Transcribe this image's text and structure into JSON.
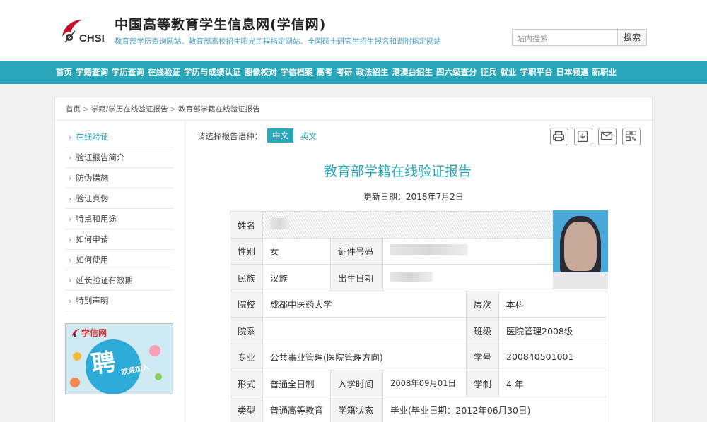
{
  "header": {
    "logo_text": "CHSI",
    "site_title": "中国高等教育学生信息网(学信网)",
    "site_subtitle": "教育部学历查询网站、教育部高校招生阳光工程指定网站、全国硕士研究生招生报名和调剂指定网站",
    "search_placeholder": "站内搜索",
    "search_button": "搜索"
  },
  "nav": [
    "首页",
    "学籍查询",
    "学历查询",
    "在线验证",
    "学历与成绩认证",
    "图像校对",
    "学信档案",
    "高考",
    "考研",
    "政法招生",
    "港澳台招生",
    "四六级查分",
    "征兵",
    "就业",
    "学职平台",
    "日本频道",
    "新职业"
  ],
  "breadcrumb": [
    "首页",
    "学籍/学历在线验证报告",
    "教育部学籍在线验证报告"
  ],
  "sidebar": {
    "items": [
      {
        "label": "在线验证",
        "active": true
      },
      {
        "label": "验证报告简介",
        "active": false
      },
      {
        "label": "防伪措施",
        "active": false
      },
      {
        "label": "验证真伪",
        "active": false
      },
      {
        "label": "特点和用途",
        "active": false
      },
      {
        "label": "如何申请",
        "active": false
      },
      {
        "label": "如何使用",
        "active": false
      },
      {
        "label": "延长验证有效期",
        "active": false
      },
      {
        "label": "特别声明",
        "active": false
      }
    ],
    "banner": {
      "logo": "学信网",
      "big": "聘",
      "small": "欢迎加入"
    }
  },
  "report": {
    "lang_label": "请选择报告语种：",
    "lang_zh": "中文",
    "lang_en": "英文",
    "tools": [
      "printer-icon",
      "download-icon",
      "mail-icon",
      "qrcode-icon"
    ],
    "title": "教育部学籍在线验证报告",
    "update_date": "更新日期：2018年7月2日",
    "fields": {
      "name_label": "姓名",
      "gender_label": "性别",
      "gender": "女",
      "id_label": "证件号码",
      "ethnicity_label": "民族",
      "ethnicity": "汉族",
      "birth_label": "出生日期",
      "school_label": "院校",
      "school": "成都中医药大学",
      "level_label": "层次",
      "level": "本科",
      "dept_label": "院系",
      "dept": "",
      "class_label": "班级",
      "class": "医院管理2008级",
      "major_label": "专业",
      "major": "公共事业管理(医院管理方向)",
      "student_no_label": "学号",
      "student_no": "200840501001",
      "form_label": "形式",
      "form": "普通全日制",
      "enroll_label": "入学时间",
      "enroll": "2008年09月01日",
      "duration_label": "学制",
      "duration": "4 年",
      "type_label": "类型",
      "type": "普通高等教育",
      "status_label": "学籍状态",
      "status": "毕业(毕业日期：2012年06月30日)"
    }
  },
  "colors": {
    "accent": "#29a6b9",
    "subtitle": "#4a9fc4"
  }
}
